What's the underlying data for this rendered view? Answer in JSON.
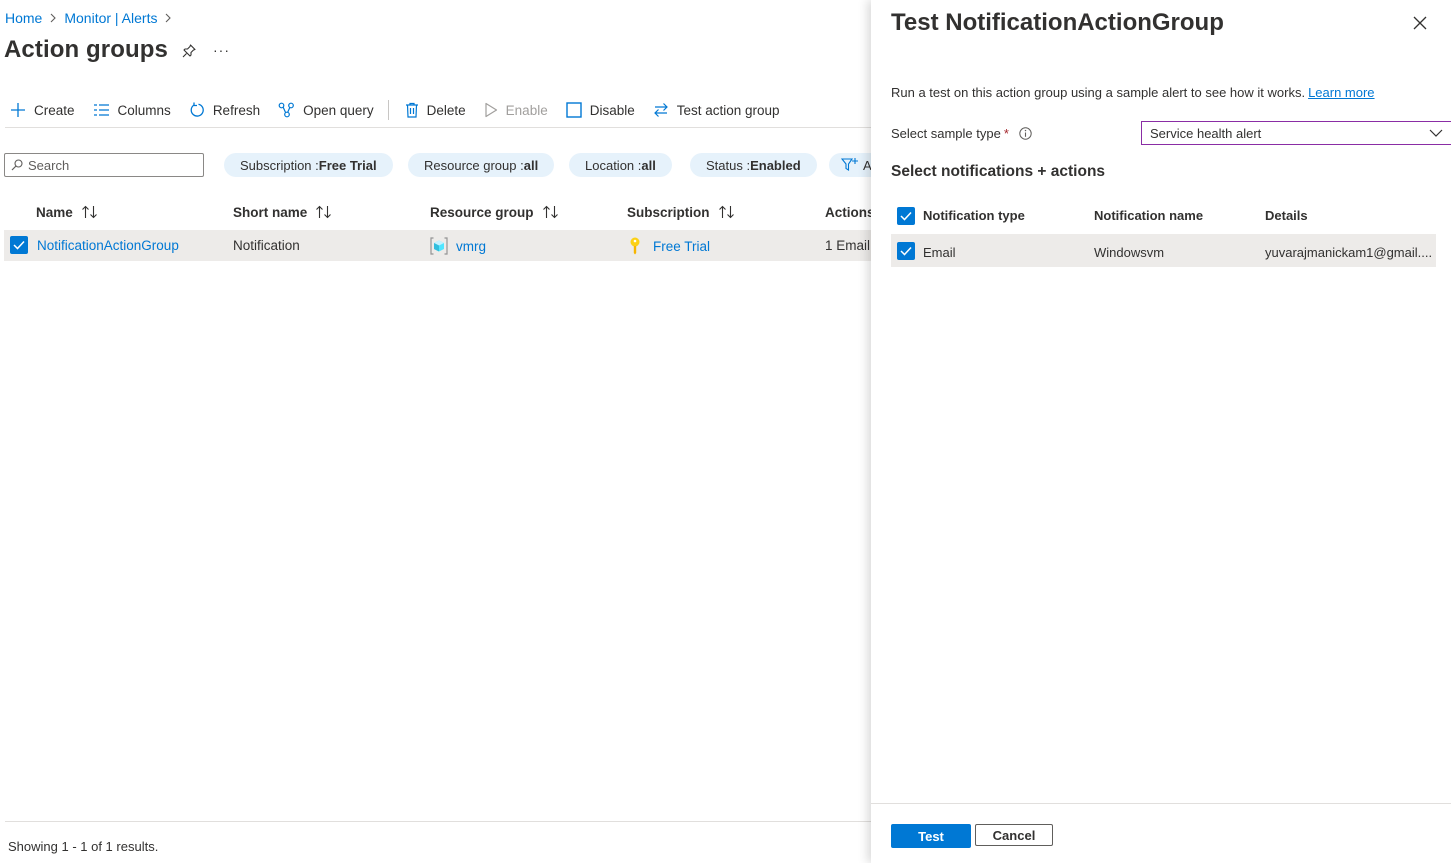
{
  "breadcrumb": {
    "items": [
      "Home",
      "Monitor | Alerts"
    ]
  },
  "page": {
    "title": "Action groups",
    "more": "···"
  },
  "toolbar": {
    "create": "Create",
    "columns": "Columns",
    "refresh": "Refresh",
    "open_query": "Open query",
    "delete": "Delete",
    "enable": "Enable",
    "disable": "Disable",
    "test_action_group": "Test action group"
  },
  "search": {
    "placeholder": "Search",
    "value": ""
  },
  "filters": [
    {
      "key": "Subscription : ",
      "value": "Free Trial"
    },
    {
      "key": "Resource group : ",
      "value": "all"
    },
    {
      "key": "Location : ",
      "value": "all"
    },
    {
      "key": "Status : ",
      "value": "Enabled"
    },
    {
      "key": "A",
      "value": ""
    }
  ],
  "grid": {
    "columns": [
      "Name",
      "Short name",
      "Resource group",
      "Subscription",
      "Actions"
    ],
    "rows": [
      {
        "name": "NotificationActionGroup",
        "short_name": "Notification",
        "resource_group": "vmrg",
        "subscription": "Free Trial",
        "actions": "1 Email",
        "selected": true
      }
    ]
  },
  "footer": {
    "results": "Showing 1 - 1 of 1 results."
  },
  "panel": {
    "title": "Test NotificationActionGroup",
    "description": "Run a test on this action group using a sample alert to see how it works.",
    "learn_more": "Learn more",
    "sample_type_label": "Select sample type",
    "required_marker": "*",
    "sample_type_value": "Service health alert",
    "section_title": "Select notifications + actions",
    "table": {
      "columns": [
        "Notification type",
        "Notification name",
        "Details"
      ],
      "rows": [
        {
          "type": "Email",
          "name": "Windowsvm",
          "details": "yuvarajmanickam1@gmail....",
          "checked": true
        }
      ]
    },
    "test_button": "Test",
    "cancel_button": "Cancel"
  },
  "colors": {
    "accent": "#0078d4",
    "pill_bg": "#e6f2fb",
    "row_selected": "#edebe9",
    "dropdown_border": "#8a2da5"
  }
}
